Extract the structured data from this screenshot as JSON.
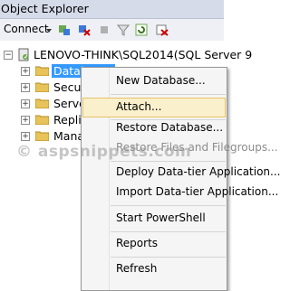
{
  "window": {
    "title": "Object Explorer"
  },
  "toolbar": {
    "connect_label": "Connect"
  },
  "tree": {
    "server": "LENOVO-THINK\\SQL2014(SQL Server 9",
    "children": [
      "Databases",
      "Security",
      "Server Objects",
      "Replication",
      "Management"
    ]
  },
  "context_menu": {
    "items": [
      "New Database...",
      "Attach...",
      "Restore Database...",
      "Restore Files and Filegroups...",
      "Deploy Data-tier Application...",
      "Import Data-tier Application...",
      "Start PowerShell",
      "Reports",
      "Refresh"
    ]
  },
  "watermark": "© aspsnippets.com",
  "colors": {
    "highlight": "#fbf0cc",
    "selection": "#3399ff"
  }
}
